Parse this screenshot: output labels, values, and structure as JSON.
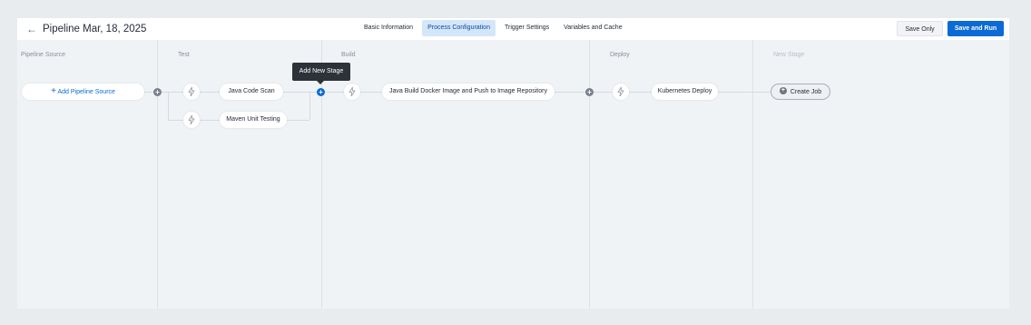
{
  "header": {
    "back_icon": "arrow-left-icon",
    "title": "Pipeline Mar, 18, 2025",
    "tabs": [
      {
        "label": "Basic Information",
        "active": false
      },
      {
        "label": "Process Configuration",
        "active": true
      },
      {
        "label": "Trigger Settings",
        "active": false
      },
      {
        "label": "Variables and Cache",
        "active": false
      }
    ],
    "save_only_label": "Save Only",
    "save_and_run_label": "Save and Run"
  },
  "stages": [
    {
      "title": "Pipeline Source"
    },
    {
      "title": "Test"
    },
    {
      "title": "Build"
    },
    {
      "title": "Deploy"
    },
    {
      "title": "New Stage"
    }
  ],
  "source": {
    "add_label": "Add Pipeline Source",
    "icon": "plus-icon"
  },
  "jobs": {
    "test": [
      "Java Code Scan",
      "Maven Unit Testing"
    ],
    "build": [
      "Java Build Docker Image and Push to Image Repository"
    ],
    "deploy": [
      "Kubernetes Deploy"
    ]
  },
  "job_icon": "lightning-icon",
  "create_job_label": "Create Job",
  "tooltip": "Add New Stage",
  "colors": {
    "primary": "#0a6ad6",
    "active_tab_bg": "#d4e6f9",
    "canvas": "#f0f3f6",
    "tooltip_bg": "#2d3138"
  }
}
